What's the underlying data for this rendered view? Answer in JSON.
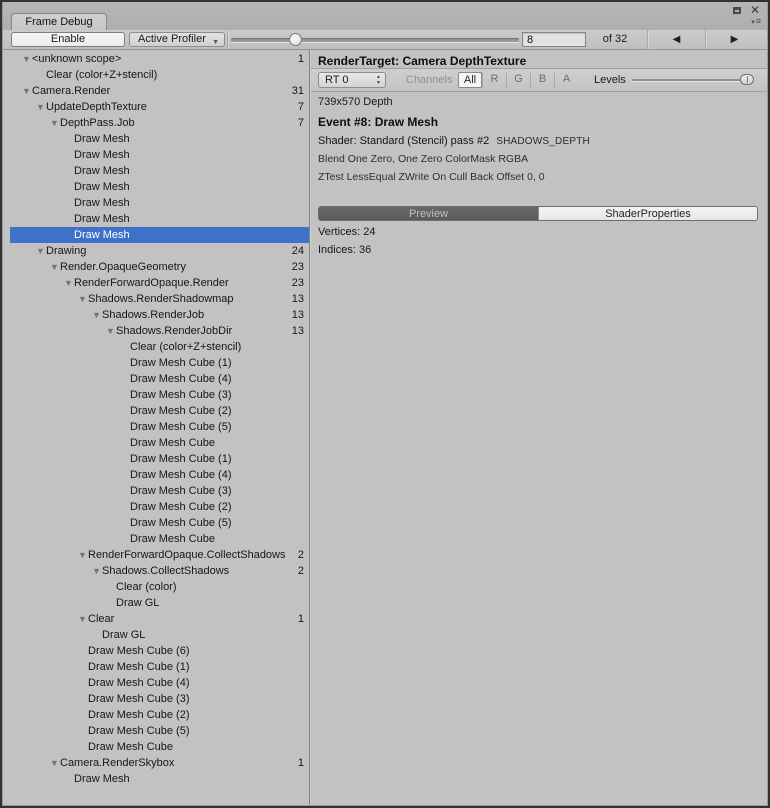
{
  "window": {
    "tab_title": "Frame Debug"
  },
  "window_controls": {
    "maximize_icon": "maximize",
    "close_icon": "✕",
    "menu_caret": "▾",
    "menu_lines": "≡"
  },
  "toolbar": {
    "enable_label": "Enable",
    "active_profiler_label": "Active Profiler",
    "dropdown_caret": "▼",
    "frame_value": "8",
    "frame_total_label": "of 32",
    "prev_icon": "◀",
    "next_icon": "▶",
    "slider": {
      "min": 1,
      "max": 32,
      "value": 8
    }
  },
  "colors": {
    "selection_blue": "#3e72c8",
    "preview_tab_bg": "#5b5b5b",
    "background_gray": "#c2c2c2"
  },
  "tree": {
    "rows": [
      {
        "depth": 0,
        "label": "<unknown scope>",
        "count": "1",
        "expander": true
      },
      {
        "depth": 1,
        "label": "Clear (color+Z+stencil)"
      },
      {
        "depth": 0,
        "label": "Camera.Render",
        "count": "31",
        "expander": true
      },
      {
        "depth": 1,
        "label": "UpdateDepthTexture",
        "count": "7",
        "expander": true
      },
      {
        "depth": 2,
        "label": "DepthPass.Job",
        "count": "7",
        "expander": true
      },
      {
        "depth": 3,
        "label": "Draw Mesh"
      },
      {
        "depth": 3,
        "label": "Draw Mesh"
      },
      {
        "depth": 3,
        "label": "Draw Mesh"
      },
      {
        "depth": 3,
        "label": "Draw Mesh"
      },
      {
        "depth": 3,
        "label": "Draw Mesh"
      },
      {
        "depth": 3,
        "label": "Draw Mesh"
      },
      {
        "depth": 3,
        "label": "Draw Mesh",
        "selected": true
      },
      {
        "depth": 1,
        "label": "Drawing",
        "count": "24",
        "expander": true
      },
      {
        "depth": 2,
        "label": "Render.OpaqueGeometry",
        "count": "23",
        "expander": true
      },
      {
        "depth": 3,
        "label": "RenderForwardOpaque.Render",
        "count": "23",
        "expander": true
      },
      {
        "depth": 4,
        "label": "Shadows.RenderShadowmap",
        "count": "13",
        "expander": true
      },
      {
        "depth": 5,
        "label": "Shadows.RenderJob",
        "count": "13",
        "expander": true
      },
      {
        "depth": 6,
        "label": "Shadows.RenderJobDir",
        "count": "13",
        "expander": true
      },
      {
        "depth": 7,
        "label": "Clear (color+Z+stencil)"
      },
      {
        "depth": 7,
        "label": "Draw Mesh Cube (1)"
      },
      {
        "depth": 7,
        "label": "Draw Mesh Cube (4)"
      },
      {
        "depth": 7,
        "label": "Draw Mesh Cube (3)"
      },
      {
        "depth": 7,
        "label": "Draw Mesh Cube (2)"
      },
      {
        "depth": 7,
        "label": "Draw Mesh Cube (5)"
      },
      {
        "depth": 7,
        "label": "Draw Mesh Cube"
      },
      {
        "depth": 7,
        "label": "Draw Mesh Cube (1)"
      },
      {
        "depth": 7,
        "label": "Draw Mesh Cube (4)"
      },
      {
        "depth": 7,
        "label": "Draw Mesh Cube (3)"
      },
      {
        "depth": 7,
        "label": "Draw Mesh Cube (2)"
      },
      {
        "depth": 7,
        "label": "Draw Mesh Cube (5)"
      },
      {
        "depth": 7,
        "label": "Draw Mesh Cube"
      },
      {
        "depth": 4,
        "label": "RenderForwardOpaque.CollectShadows",
        "count": "2",
        "expander": true
      },
      {
        "depth": 5,
        "label": "Shadows.CollectShadows",
        "count": "2",
        "expander": true
      },
      {
        "depth": 6,
        "label": "Clear (color)"
      },
      {
        "depth": 6,
        "label": "Draw GL"
      },
      {
        "depth": 4,
        "label": "Clear",
        "count": "1",
        "expander": true
      },
      {
        "depth": 5,
        "label": "Draw GL"
      },
      {
        "depth": 4,
        "label": "Draw Mesh Cube (6)"
      },
      {
        "depth": 4,
        "label": "Draw Mesh Cube (1)"
      },
      {
        "depth": 4,
        "label": "Draw Mesh Cube (4)"
      },
      {
        "depth": 4,
        "label": "Draw Mesh Cube (3)"
      },
      {
        "depth": 4,
        "label": "Draw Mesh Cube (2)"
      },
      {
        "depth": 4,
        "label": "Draw Mesh Cube (5)"
      },
      {
        "depth": 4,
        "label": "Draw Mesh Cube"
      },
      {
        "depth": 2,
        "label": "Camera.RenderSkybox",
        "count": "1",
        "expander": true
      },
      {
        "depth": 3,
        "label": "Draw Mesh"
      }
    ]
  },
  "detail": {
    "render_target_title": "RenderTarget: Camera DepthTexture",
    "rt_toolbar": {
      "rt_select_value": "RT 0",
      "channels_label": "Channels",
      "channel_buttons": [
        "All",
        "R",
        "G",
        "B",
        "A"
      ],
      "selected_channel": "All",
      "levels_label": "Levels"
    },
    "size_line": "739x570 Depth",
    "event_title": "Event #8: Draw Mesh",
    "shader_line": "Shader: Standard (Stencil) pass #2",
    "shader_keyword": "SHADOWS_DEPTH",
    "blend_line": "Blend One Zero, One Zero ColorMask RGBA",
    "ztest_line": "ZTest LessEqual ZWrite On Cull Back Offset 0, 0",
    "tabs": [
      {
        "label": "Preview",
        "selected": true
      },
      {
        "label": "ShaderProperties",
        "selected": false
      }
    ],
    "mesh_info": {
      "vertices_label": "Vertices:",
      "vertices_value": "24",
      "indices_label": "Indices:",
      "indices_value": "36"
    }
  }
}
